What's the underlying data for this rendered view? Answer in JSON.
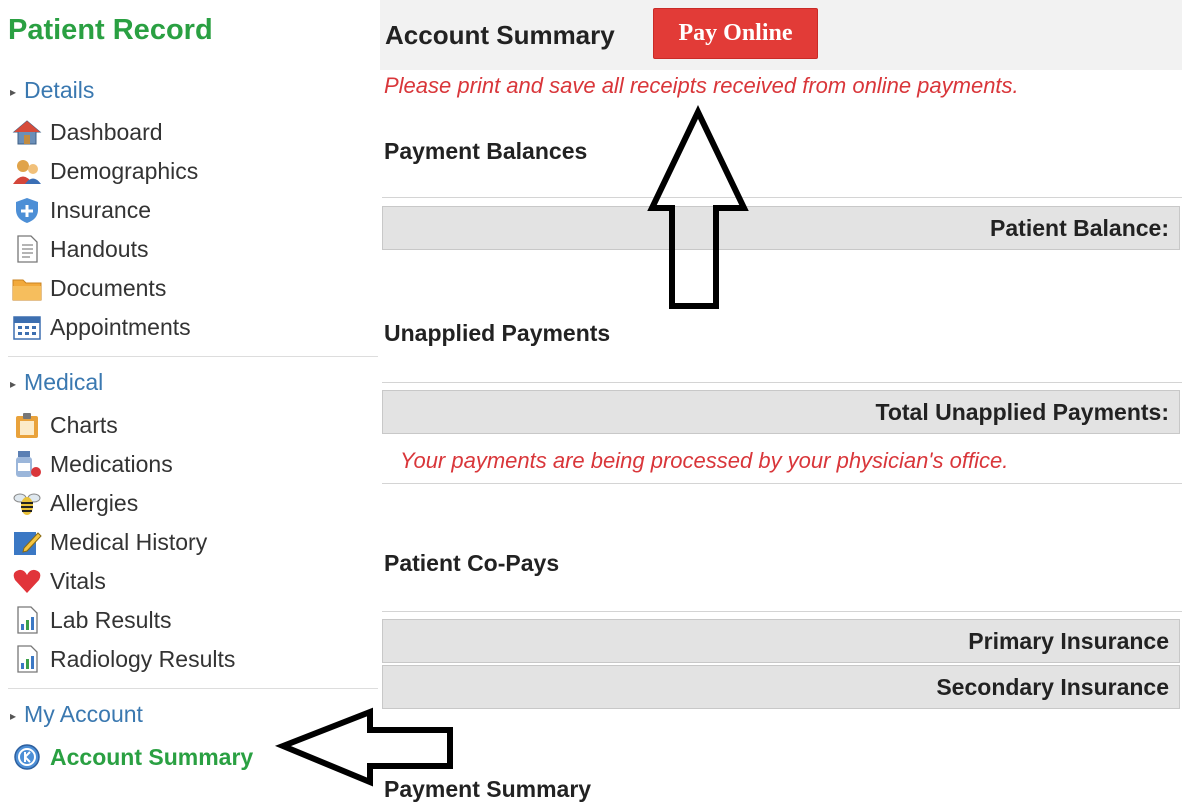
{
  "sidebar": {
    "title": "Patient Record",
    "sections": [
      {
        "label": "Details"
      },
      {
        "label": "Medical"
      },
      {
        "label": "My Account"
      }
    ],
    "details_items": [
      {
        "label": "Dashboard",
        "icon": "home-icon"
      },
      {
        "label": "Demographics",
        "icon": "people-icon"
      },
      {
        "label": "Insurance",
        "icon": "shield-icon"
      },
      {
        "label": "Handouts",
        "icon": "document-icon"
      },
      {
        "label": "Documents",
        "icon": "folder-icon"
      },
      {
        "label": "Appointments",
        "icon": "calendar-icon"
      }
    ],
    "medical_items": [
      {
        "label": "Charts",
        "icon": "clipboard-icon"
      },
      {
        "label": "Medications",
        "icon": "pill-bottle-icon"
      },
      {
        "label": "Allergies",
        "icon": "bee-icon"
      },
      {
        "label": "Medical History",
        "icon": "edit-icon"
      },
      {
        "label": "Vitals",
        "icon": "heart-icon"
      },
      {
        "label": "Lab Results",
        "icon": "report-icon"
      },
      {
        "label": "Radiology Results",
        "icon": "report-icon"
      }
    ],
    "account_items": [
      {
        "label": "Account Summary",
        "icon": "account-icon",
        "active": true
      }
    ]
  },
  "main": {
    "title": "Account Summary",
    "pay_button": "Pay Online",
    "notice": "Please print and save all receipts received from online payments.",
    "sections": {
      "payment_balances": {
        "title": "Payment Balances",
        "row_label": "Patient Balance:"
      },
      "unapplied": {
        "title": "Unapplied Payments",
        "row_label": "Total Unapplied Payments:",
        "message": "Your payments are being processed by your physician's office."
      },
      "copays": {
        "title": "Patient Co-Pays",
        "rows": [
          "Primary Insurance",
          "Secondary Insurance"
        ]
      },
      "summary": {
        "title": "Payment Summary"
      }
    }
  },
  "colors": {
    "brand_green": "#2aa042",
    "link_blue": "#3a78b0",
    "alert_red": "#d9363a",
    "button_red": "#e23b37"
  }
}
